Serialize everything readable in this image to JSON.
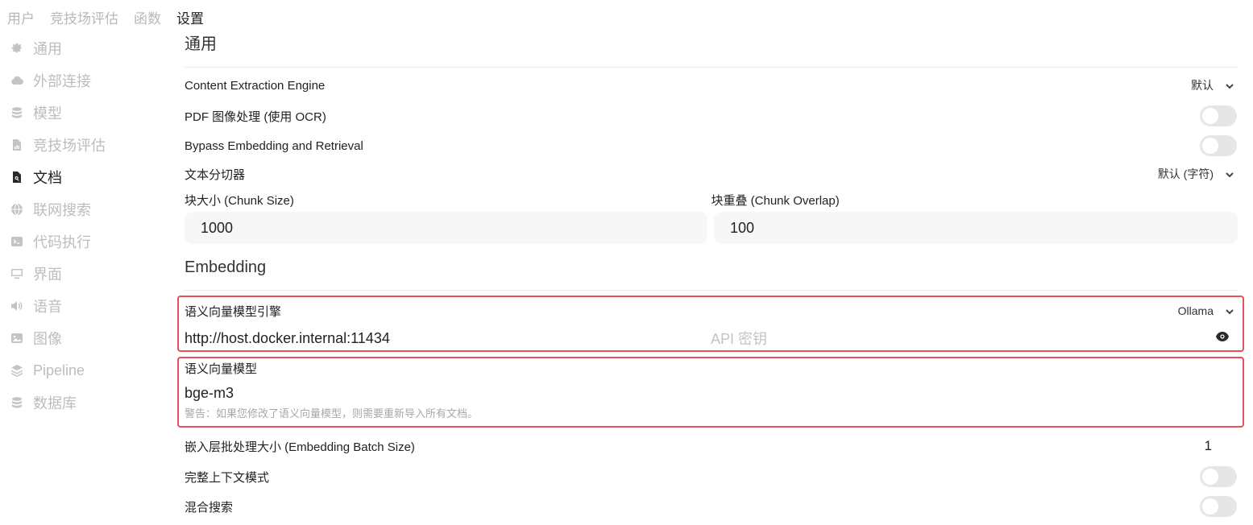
{
  "top_tabs": [
    {
      "label": "用户"
    },
    {
      "label": "竞技场评估"
    },
    {
      "label": "函数"
    },
    {
      "label": "设置"
    }
  ],
  "sidebar": {
    "items": [
      {
        "label": "通用",
        "icon": "gear-icon"
      },
      {
        "label": "外部连接",
        "icon": "cloud-icon"
      },
      {
        "label": "模型",
        "icon": "database-icon"
      },
      {
        "label": "竞技场评估",
        "icon": "chart-document-icon"
      },
      {
        "label": "文档",
        "icon": "document-search-icon"
      },
      {
        "label": "联网搜索",
        "icon": "globe-icon"
      },
      {
        "label": "代码执行",
        "icon": "terminal-icon"
      },
      {
        "label": "界面",
        "icon": "monitor-icon"
      },
      {
        "label": "语音",
        "icon": "speaker-icon"
      },
      {
        "label": "图像",
        "icon": "image-icon"
      },
      {
        "label": "Pipeline",
        "icon": "layers-icon"
      },
      {
        "label": "数据库",
        "icon": "database-icon"
      }
    ]
  },
  "general": {
    "title": "通用",
    "extraction_engine_label": "Content Extraction Engine",
    "extraction_engine_value": "默认",
    "pdf_ocr_label": "PDF 图像处理 (使用 OCR)",
    "bypass_label": "Bypass Embedding and Retrieval",
    "splitter_label": "文本分切器",
    "splitter_value": "默认 (字符)",
    "chunk_size_label": "块大小 (Chunk Size)",
    "chunk_size_value": "1000",
    "chunk_overlap_label": "块重叠 (Chunk Overlap)",
    "chunk_overlap_value": "100"
  },
  "embedding": {
    "title": "Embedding",
    "engine_label": "语义向量模型引擎",
    "engine_value": "Ollama",
    "url_value": "http://host.docker.internal:11434",
    "api_key_placeholder": "API 密钥",
    "model_label": "语义向量模型",
    "model_value": "bge-m3",
    "warning": "警告：如果您修改了语义向量模型，则需要重新导入所有文档。",
    "batch_size_label": "嵌入层批处理大小 (Embedding Batch Size)",
    "batch_size_value": "1",
    "full_context_label": "完整上下文模式",
    "hybrid_search_label": "混合搜索"
  },
  "colors": {
    "highlight_border": "#e8505b",
    "toggle_off": "#e6e6e6",
    "muted_text": "#bdbdbd"
  }
}
